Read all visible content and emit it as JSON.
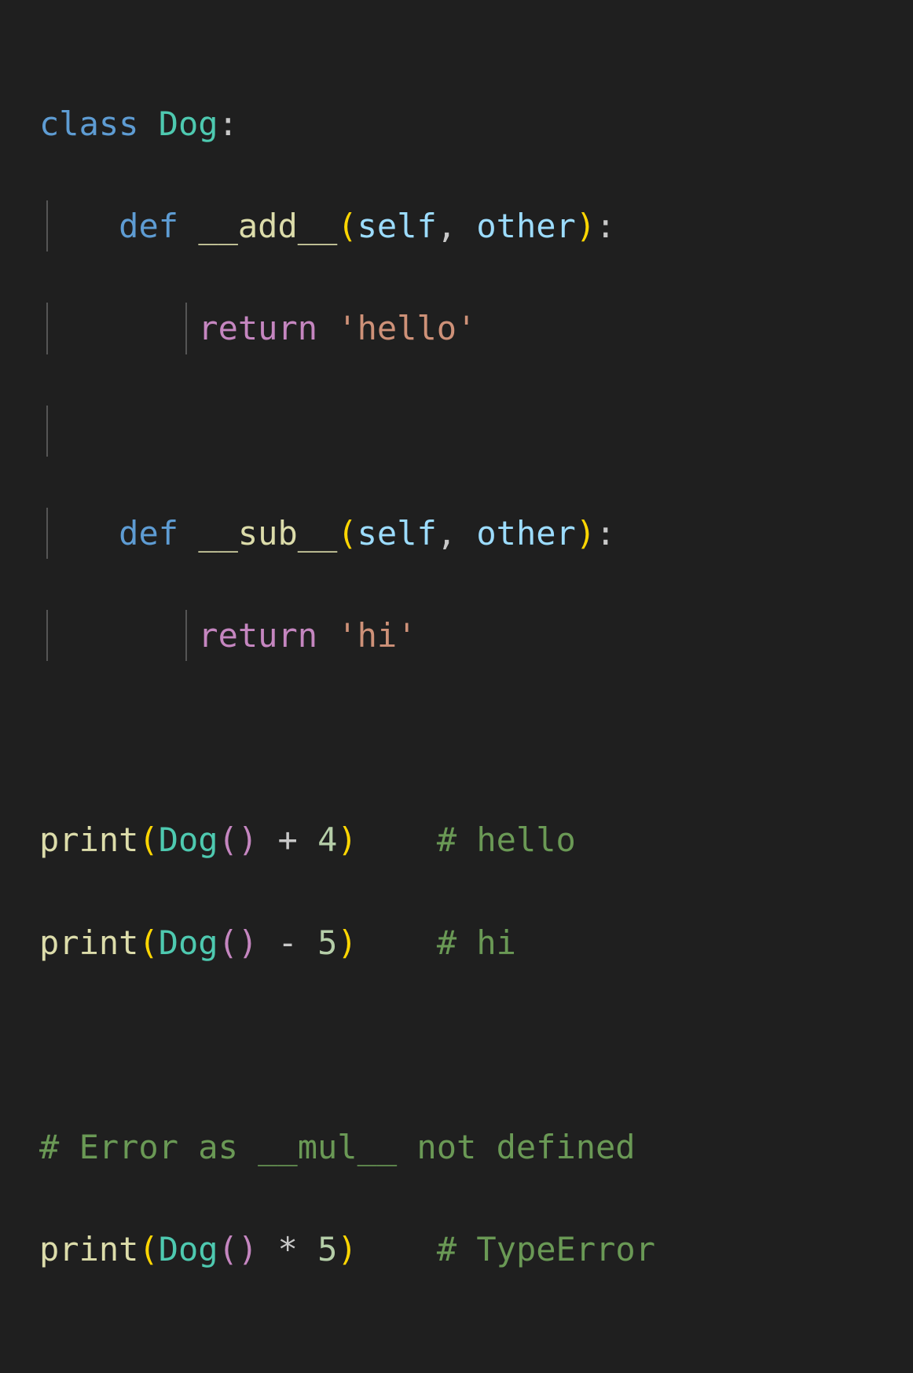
{
  "code": {
    "l1_class": "class",
    "l1_name": "Dog",
    "l1_colon": ":",
    "l2_def": "def",
    "l2_fn": "__add__",
    "l2_lpar": "(",
    "l2_self": "self",
    "l2_comma": ",",
    "l2_other": "other",
    "l2_rpar": ")",
    "l2_colon": ":",
    "l3_return": "return",
    "l3_str": "'hello'",
    "l5_def": "def",
    "l5_fn": "__sub__",
    "l5_lpar": "(",
    "l5_self": "self",
    "l5_comma": ",",
    "l5_other": "other",
    "l5_rpar": ")",
    "l5_colon": ":",
    "l6_return": "return",
    "l6_str": "'hi'",
    "l8_print": "print",
    "l8_lpar": "(",
    "l8_dog": "Dog",
    "l8_lpar2": "(",
    "l8_rpar2": ")",
    "l8_op": "+",
    "l8_num": "4",
    "l8_rpar": ")",
    "l8_cmt": "# hello",
    "l9_print": "print",
    "l9_lpar": "(",
    "l9_dog": "Dog",
    "l9_lpar2": "(",
    "l9_rpar2": ")",
    "l9_op": "-",
    "l9_num": "5",
    "l9_rpar": ")",
    "l9_cmt": "# hi",
    "l11_cmt": "# Error as __mul__ not defined",
    "l12_print": "print",
    "l12_lpar": "(",
    "l12_dog": "Dog",
    "l12_lpar2": "(",
    "l12_rpar2": ")",
    "l12_op": "*",
    "l12_num": "5",
    "l12_rpar": ")",
    "l12_cmt": "# TypeError"
  }
}
